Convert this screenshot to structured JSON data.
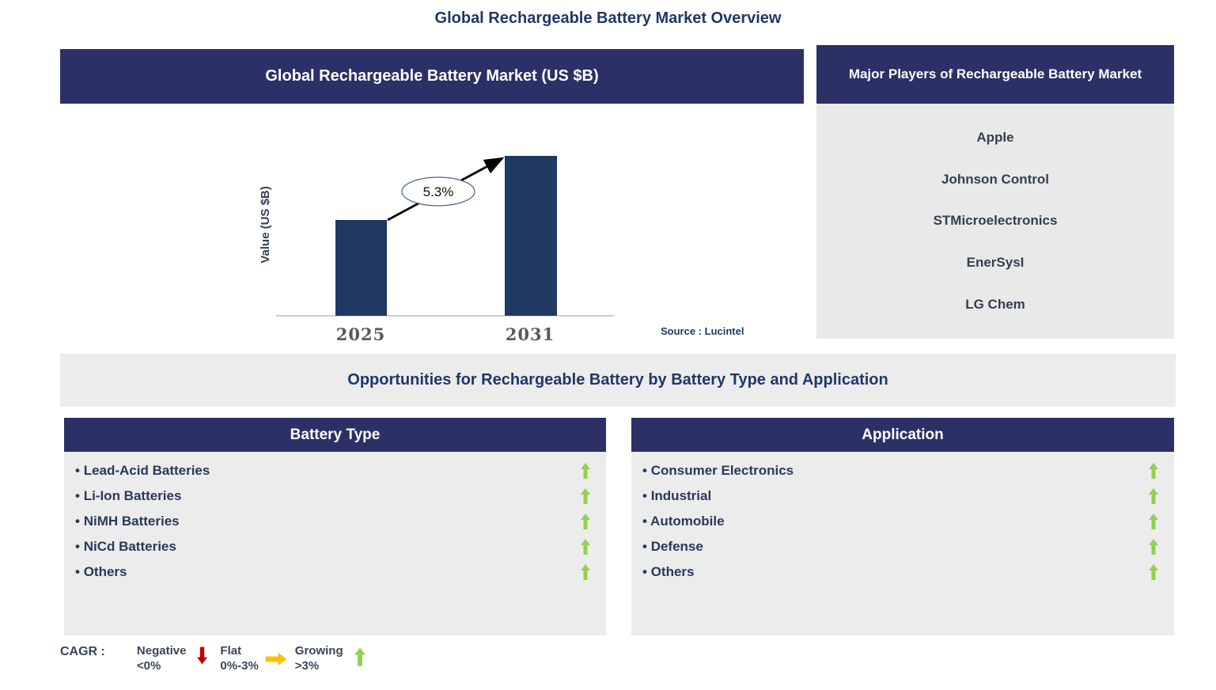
{
  "page_title": "Global Rechargeable Battery Market Overview",
  "chart_panel": {
    "header": "Global Rechargeable Battery Market (US $B)",
    "source": "Source : Lucintel"
  },
  "chart_data": {
    "type": "bar",
    "title": "Global Rechargeable Battery Market (US $B)",
    "categories": [
      "2025",
      "2031"
    ],
    "values": [
      121,
      202
    ],
    "values_note": "y-axis has no tick labels; values are relative bar heights",
    "ylabel": "Value (US $B)",
    "xlabel": "",
    "annotation": "5.3%",
    "grid": false,
    "legend": false,
    "bar_color": "#1F3864"
  },
  "players_panel": {
    "header": "Major Players of Rechargeable Battery Market",
    "players": [
      "Apple",
      "Johnson Control",
      "STMicroelectronics",
      "EnerSysI",
      "LG Chem"
    ]
  },
  "opportunities_title": "Opportunities for Rechargeable Battery by Battery Type and Application",
  "battery_type": {
    "header": "Battery Type",
    "items": [
      {
        "label": "Lead-Acid Batteries",
        "trend": "growing"
      },
      {
        "label": "Li-Ion Batteries",
        "trend": "growing"
      },
      {
        "label": "NiMH Batteries",
        "trend": "growing"
      },
      {
        "label": "NiCd Batteries",
        "trend": "growing"
      },
      {
        "label": "Others",
        "trend": "growing"
      }
    ]
  },
  "application": {
    "header": "Application",
    "items": [
      {
        "label": "Consumer Electronics",
        "trend": "growing"
      },
      {
        "label": "Industrial",
        "trend": "growing"
      },
      {
        "label": "Automobile",
        "trend": "growing"
      },
      {
        "label": "Defense",
        "trend": "growing"
      },
      {
        "label": "Others",
        "trend": "growing"
      }
    ]
  },
  "cagr_legend": {
    "label": "CAGR  :",
    "entries": [
      {
        "name": "Negative",
        "range": "<0%",
        "direction": "down",
        "color": "#C00000"
      },
      {
        "name": "Flat",
        "range": "0%-3%",
        "direction": "right",
        "color": "#FFC000"
      },
      {
        "name": "Growing",
        "range": ">3%",
        "direction": "up",
        "color": "#92D050"
      }
    ]
  },
  "colors": {
    "header_navy": "#2B3166",
    "bar_navy": "#1F3864",
    "panel_gray": "#ECECEC",
    "players_gray": "#E9E9E9",
    "growing_green": "#92D050",
    "negative_red": "#C00000",
    "flat_orange": "#FFC000",
    "title_navy": "#1E3868",
    "year_label_gray": "#595959"
  }
}
